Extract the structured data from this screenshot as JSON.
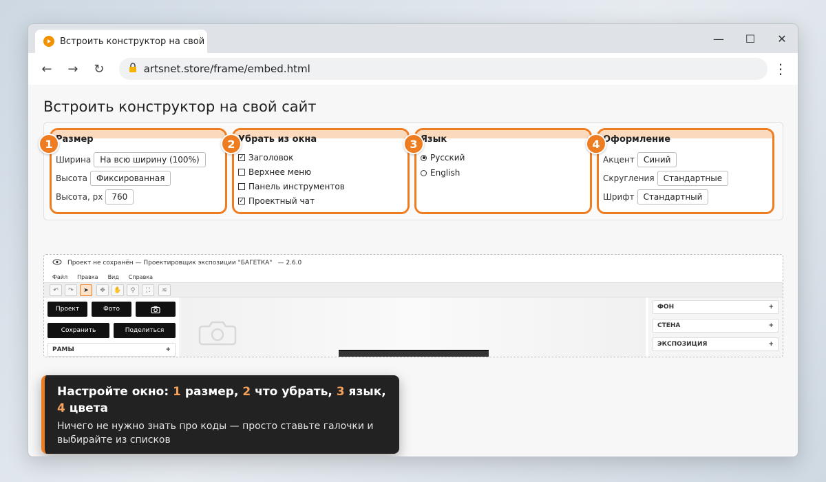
{
  "browser": {
    "tab_title": "Встроить конструктор на свой сайт",
    "url": "artsnet.store/frame/embed.html",
    "controls": {
      "minimize": "—",
      "maximize": "☐",
      "close": "✕"
    },
    "nav": {
      "back": "←",
      "forward": "→",
      "reload": "↻",
      "menu": "⋮"
    },
    "accent_color": "#f39200"
  },
  "page": {
    "title": "Встроить конструктор на свой сайт"
  },
  "settings": {
    "size": {
      "badge": "1",
      "title": "Размер",
      "width_label": "Ширина",
      "width_value": "На всю ширину (100%)",
      "height_label": "Высота",
      "height_value": "Фиксированная",
      "height_px_label": "Высота, px",
      "height_px_value": "760"
    },
    "remove": {
      "badge": "2",
      "title": "Убрать из окна",
      "items": [
        {
          "label": "Заголовок",
          "checked": true
        },
        {
          "label": "Верхнее меню",
          "checked": false
        },
        {
          "label": "Панель инструментов",
          "checked": false
        },
        {
          "label": "Проектный чат",
          "checked": true
        }
      ]
    },
    "language": {
      "badge": "3",
      "title": "Язык",
      "options": [
        {
          "label": "Русский",
          "selected": true
        },
        {
          "label": "English",
          "selected": false
        }
      ]
    },
    "style": {
      "badge": "4",
      "title": "Оформление",
      "accent_label": "Акцент",
      "accent_value": "Синий",
      "radius_label": "Скругления",
      "radius_value": "Стандартные",
      "font_label": "Шрифт",
      "font_value": "Стандартный"
    },
    "highlight_color": "#ee7d22"
  },
  "preview": {
    "title": "Проект не сохранён — Проектировщик экспозиции \"БАГЕТКА\"",
    "version": "— 2.6.0",
    "menu": [
      "Файл",
      "Правка",
      "Вид",
      "Справка"
    ],
    "buttons": {
      "project": "Проект",
      "photo": "Фото",
      "save": "Сохранить",
      "share": "Поделиться"
    },
    "left_section": "РАМЫ",
    "right_sections": [
      "ФОН",
      "СТЕНА",
      "ЭКСПОЗИЦИЯ"
    ],
    "plus": "+"
  },
  "tooltip": {
    "prefix": "Настройте окно: ",
    "n1": "1",
    "t1": " размер, ",
    "n2": "2",
    "t2": " что убрать, ",
    "n3": "3",
    "t3": " язык, ",
    "n4": "4",
    "t4": " цвета",
    "body": "Ничего не нужно знать про коды — просто ставьте галочки и выбирайте из списков"
  }
}
